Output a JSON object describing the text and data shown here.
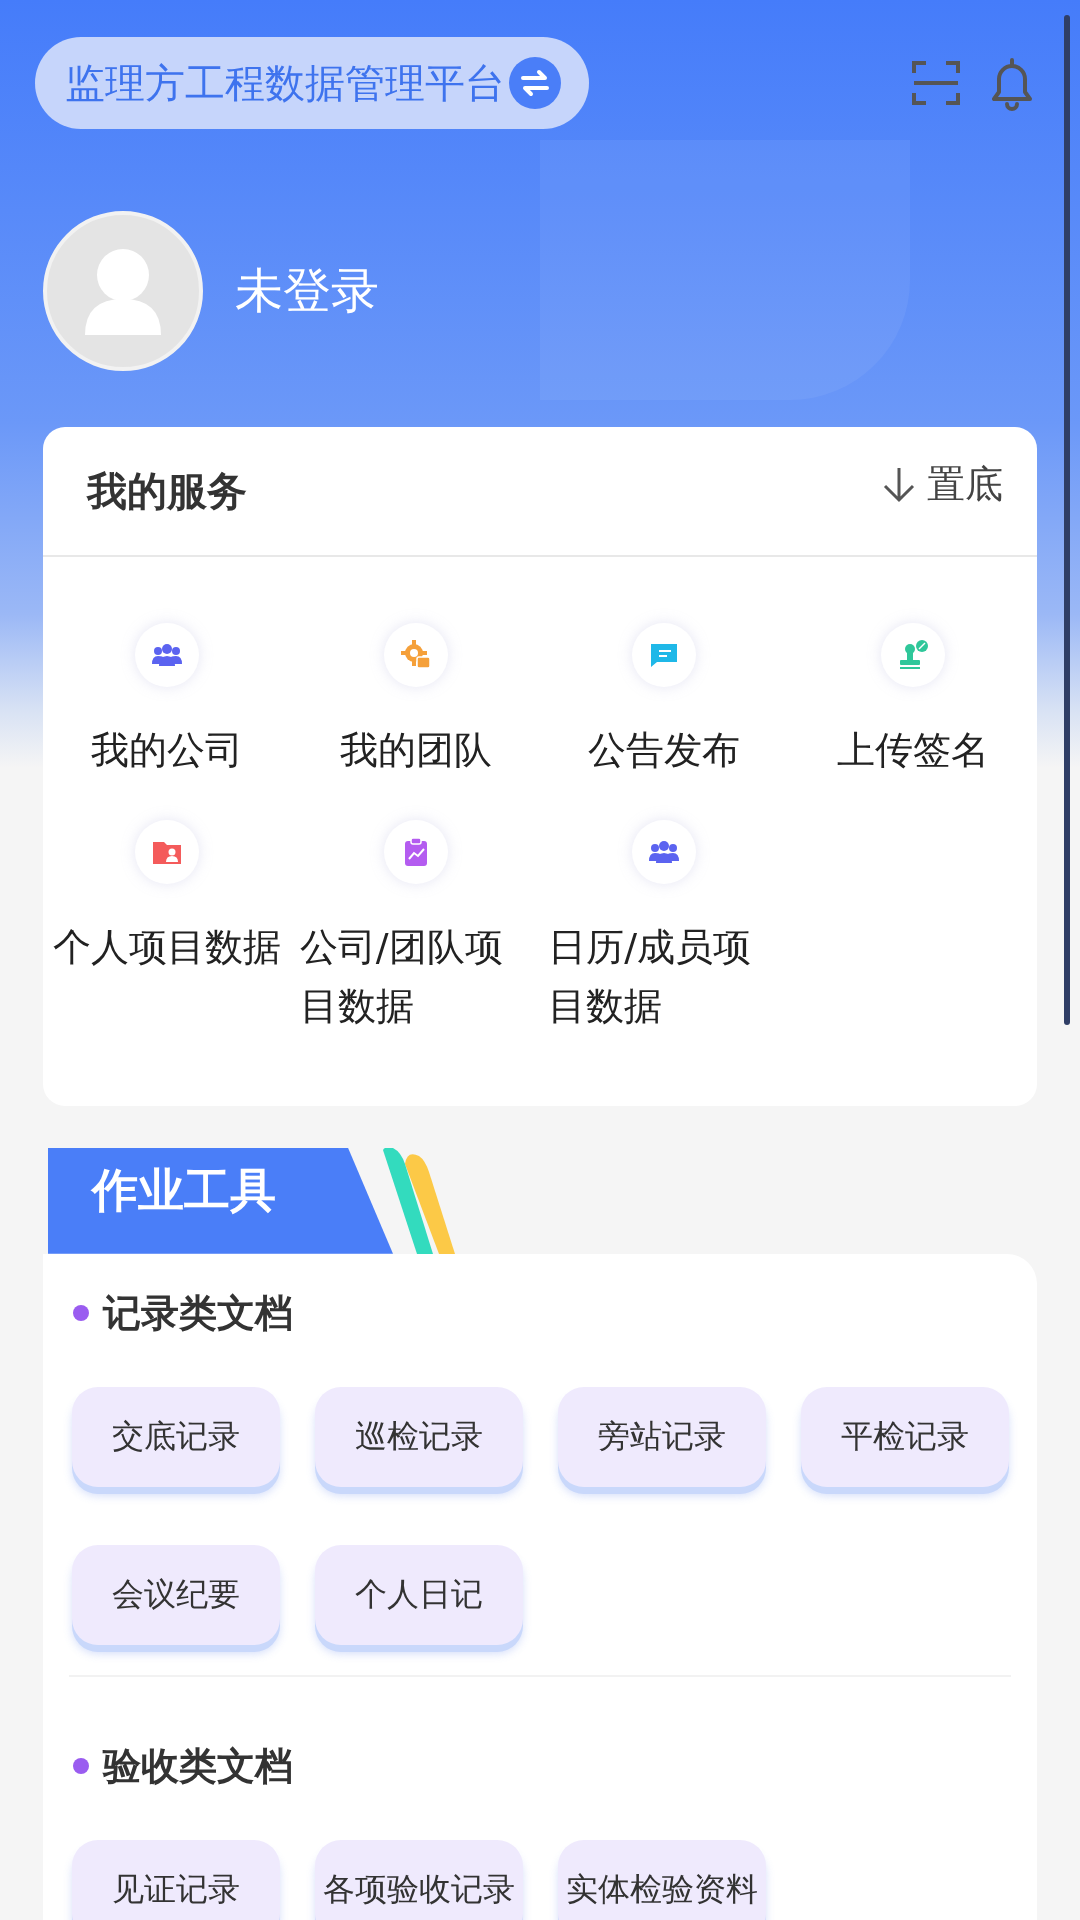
{
  "header": {
    "title": "监理方工程数据管理平台"
  },
  "user": {
    "name": "未登录"
  },
  "services": {
    "title": "我的服务",
    "pin_label": "置底",
    "items": [
      {
        "label": "我的公司",
        "kind": "group"
      },
      {
        "label": "我的团队",
        "kind": "gear"
      },
      {
        "label": "公告发布",
        "kind": "notice"
      },
      {
        "label": "上传签名",
        "kind": "stamp"
      },
      {
        "label": "个人项目数据",
        "kind": "folder"
      },
      {
        "label": "公司/团队项目数据",
        "kind": "clipboard"
      },
      {
        "label": "日历/成员项目数据",
        "kind": "group"
      }
    ]
  },
  "tools": {
    "title": "作业工具",
    "sections": [
      {
        "title": "记录类文档",
        "buttons": [
          "交底记录",
          "巡检记录",
          "旁站记录",
          "平检记录",
          "会议纪要",
          "个人日记"
        ]
      },
      {
        "title": "验收类文档",
        "buttons": [
          "见证记录",
          "各项验收记录",
          "实体检验资料"
        ]
      }
    ]
  }
}
